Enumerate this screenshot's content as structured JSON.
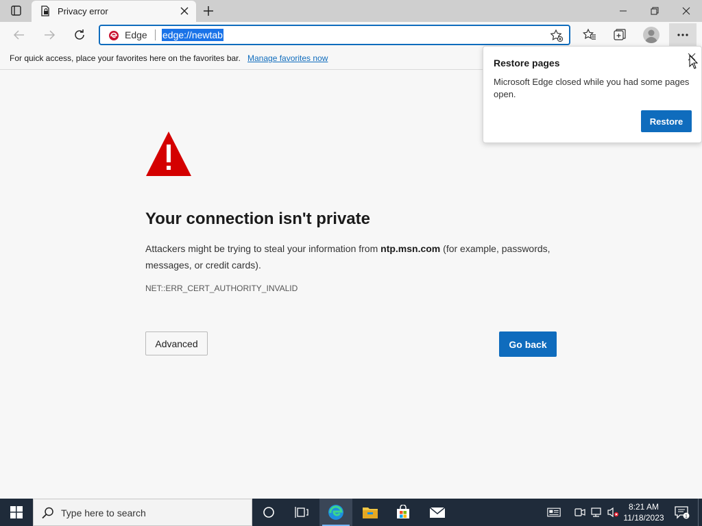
{
  "tab": {
    "title": "Privacy error"
  },
  "address_bar": {
    "brand": "Edge",
    "url": "edge://newtab"
  },
  "favorites_bar": {
    "hint": "For quick access, place your favorites here on the favorites bar.",
    "link": "Manage favorites now"
  },
  "error_page": {
    "heading": "Your connection isn't private",
    "desc_before": "Attackers might be trying to steal your information from ",
    "desc_host": "ntp.msn.com",
    "desc_after": " (for example, passwords, messages, or credit cards).",
    "error_code": "NET::ERR_CERT_AUTHORITY_INVALID",
    "advanced_label": "Advanced",
    "go_back_label": "Go back"
  },
  "restore_popup": {
    "title": "Restore pages",
    "message": "Microsoft Edge closed while you had some pages open.",
    "restore_label": "Restore"
  },
  "taskbar": {
    "search_placeholder": "Type here to search",
    "time": "8:21 AM",
    "date": "11/18/2023",
    "notification_count": "1"
  },
  "colors": {
    "accent": "#0f6cbd",
    "warning": "#d40000",
    "taskbar": "#1f2b3a"
  }
}
